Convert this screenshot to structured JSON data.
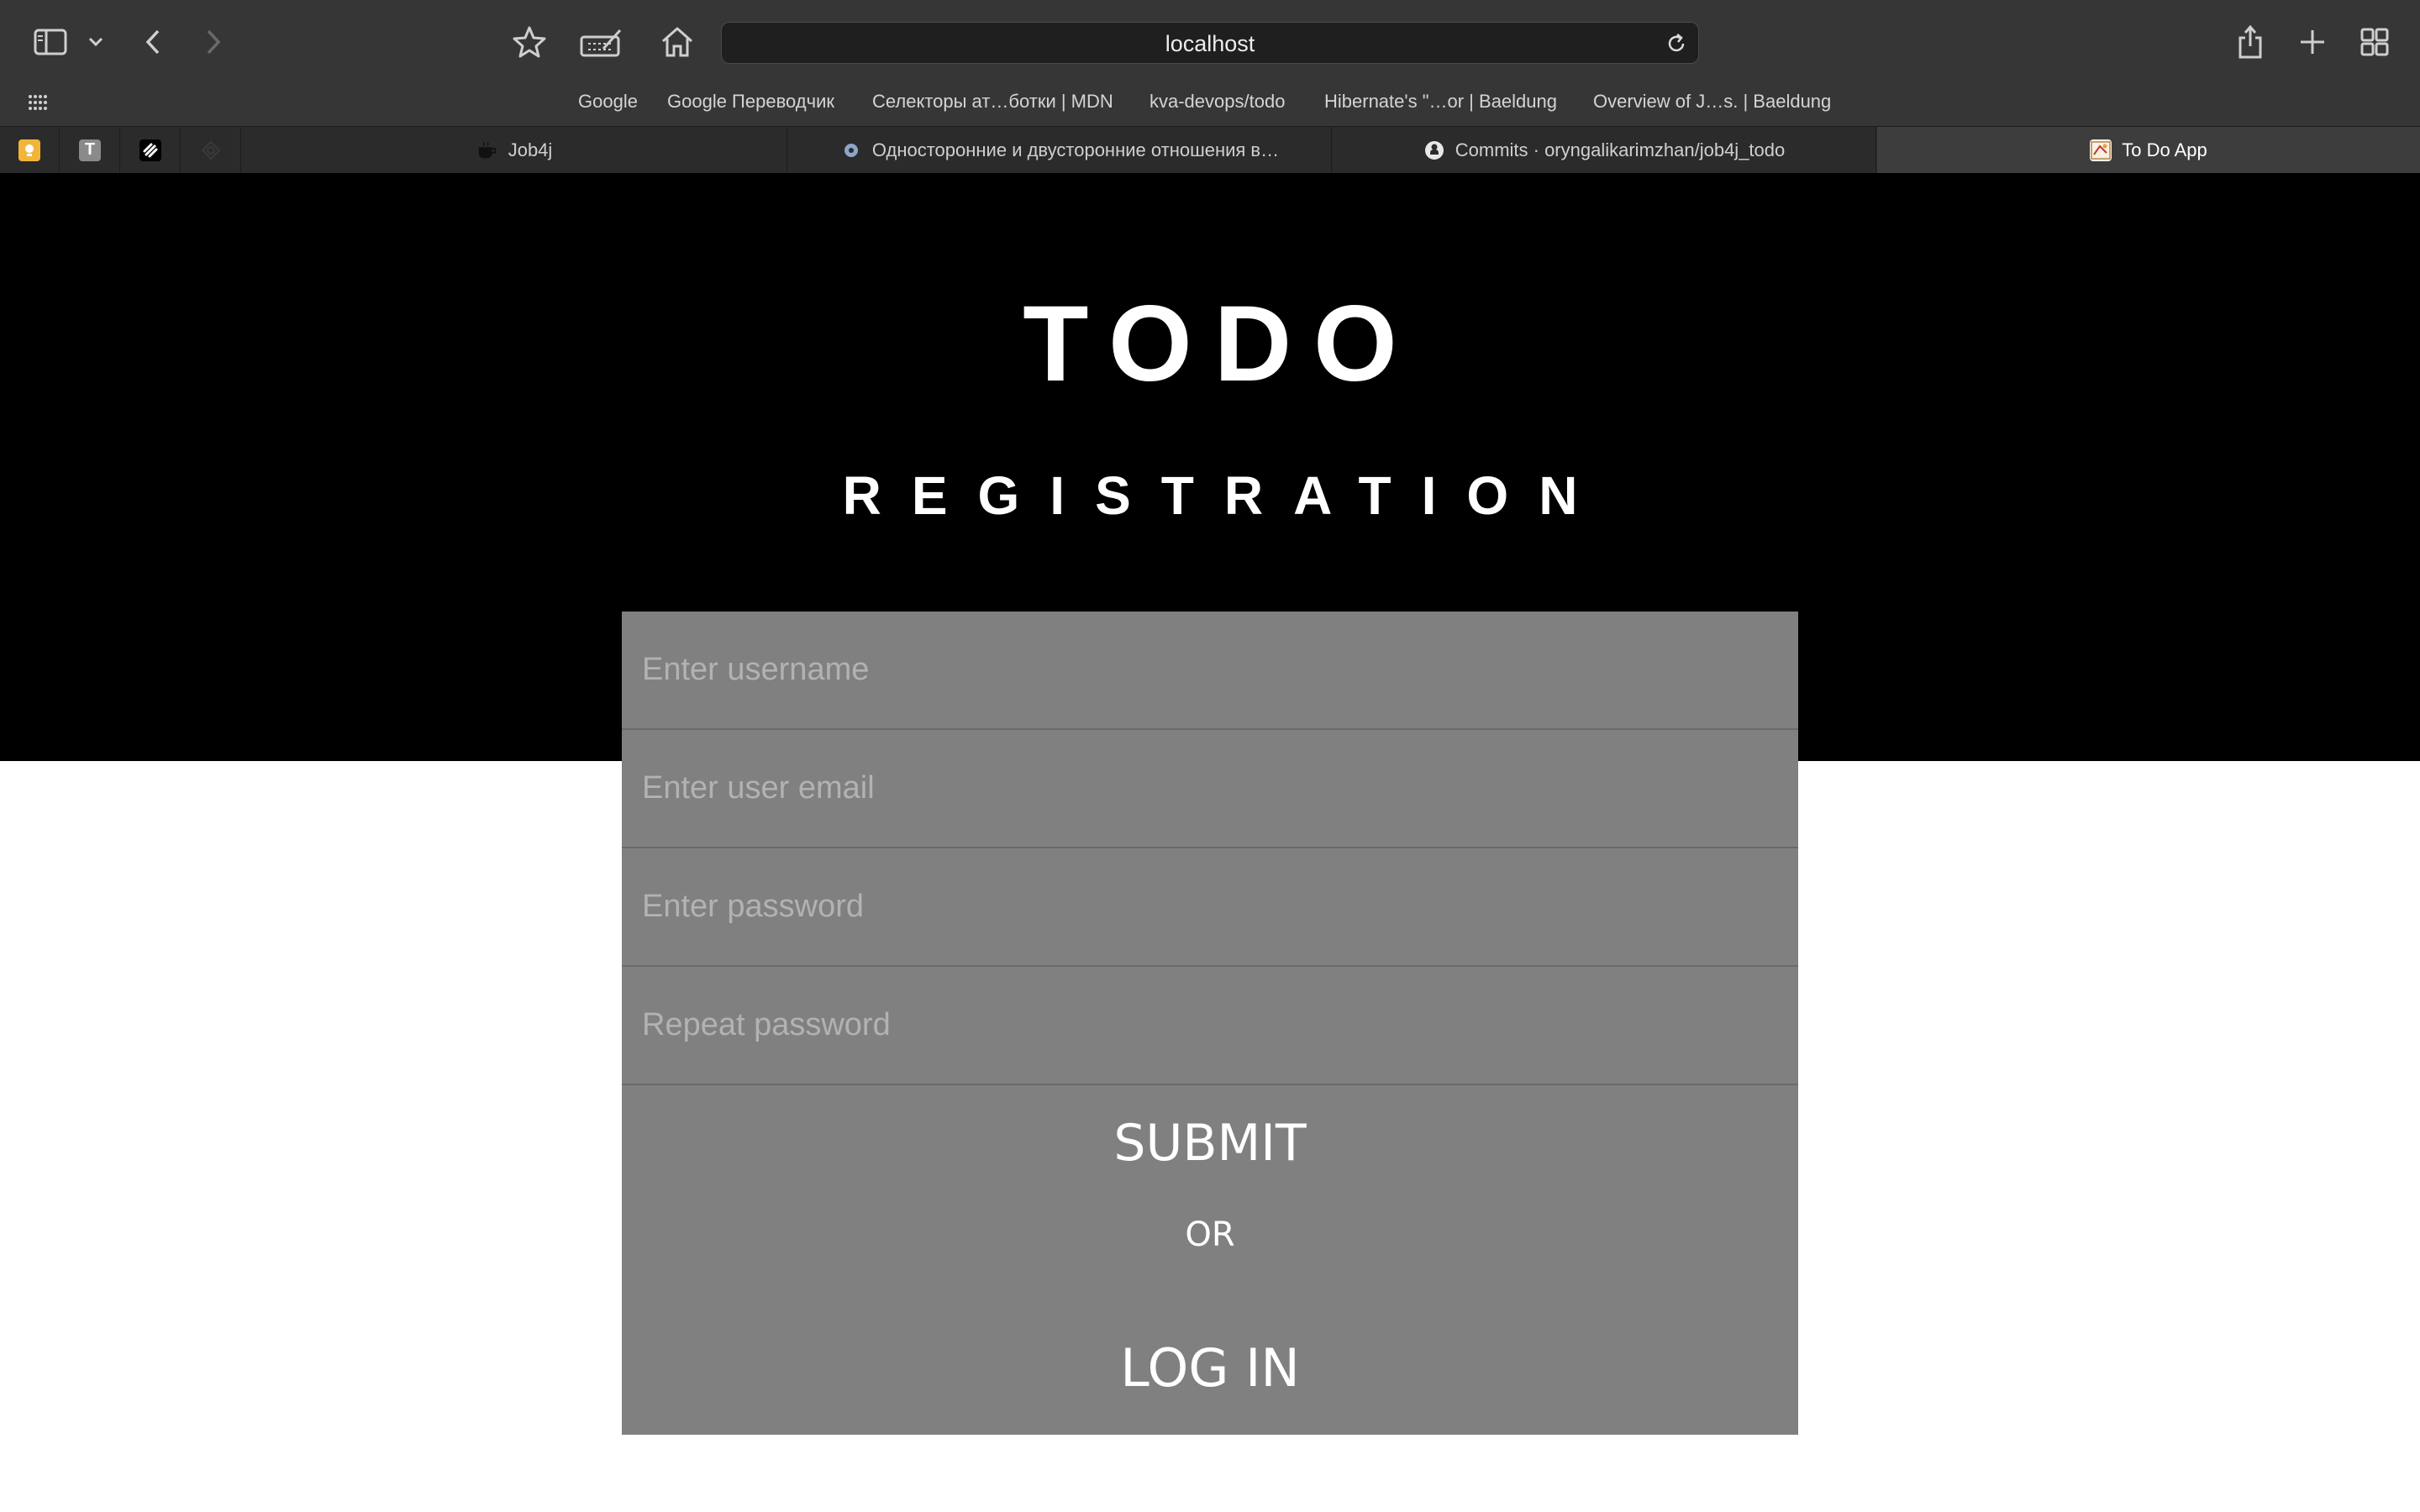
{
  "browser": {
    "address": "localhost",
    "icons": [
      "sidebar-icon",
      "chevron-down-icon",
      "back-icon",
      "forward-icon",
      "star-icon",
      "reader-icon",
      "home-icon",
      "reload-icon",
      "share-icon",
      "plus-icon",
      "tab-overview-icon",
      "grid-icon"
    ],
    "bookmarks": [
      "Google",
      "Google Переводчик",
      "Селекторы ат…ботки | MDN",
      "kva-devops/todo",
      "Hibernate's \"…or | Baeldung",
      "Overview of J…s. | Baeldung"
    ],
    "tabs": [
      {
        "label": "Job4j",
        "active": false
      },
      {
        "label": "Односторонние и двусторонние отношения в…",
        "active": false
      },
      {
        "label": "Commits · oryngalikarimzhan/job4j_todo",
        "active": false
      },
      {
        "label": "To Do App",
        "active": true
      }
    ]
  },
  "page": {
    "title": "TODO",
    "subtitle": "REGISTRATION",
    "form": {
      "username_placeholder": "Enter username",
      "email_placeholder": "Enter user email",
      "password_placeholder": "Enter password",
      "repeat_placeholder": "Repeat password",
      "submit_label": "SUBMIT",
      "or_label": "OR",
      "login_label": "LOG IN"
    },
    "colors": {
      "hero_bg": "#000000",
      "form_bg": "#808080",
      "chrome_bg": "#363636"
    }
  }
}
